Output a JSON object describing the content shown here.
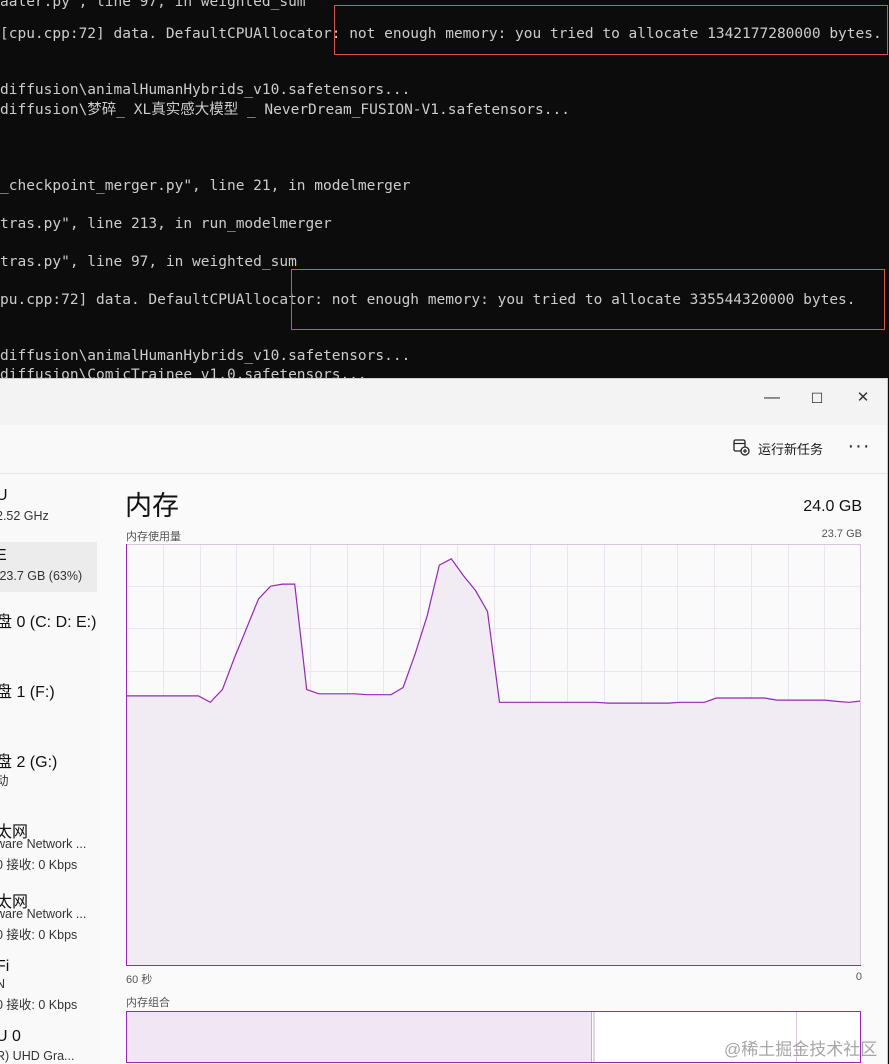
{
  "terminal": {
    "lines": [
      "[cpu.cpp:72] data. DefaultCPUAllocator: not enough memory: you tried to allocate 1342177280000 bytes.",
      "diffusion\\animalHumanHybrids_v10.safetensors...",
      "diffusion\\梦碎_ XL真实感大模型 _ NeverDream_FUSION-V1.safetensors...",
      "_checkpoint_merger.py\", line 21, in modelmerger",
      "tras.py\", line 213, in run_modelmerger",
      "tras.py\", line 97, in weighted_sum",
      "pu.cpp:72] data. DefaultCPUAllocator: not enough memory: you tried to allocate 335544320000 bytes.",
      "diffusion\\animalHumanHybrids_v10.safetensors...",
      "diffusion\\ComicTrainee_v1.0.safetensors..."
    ],
    "top_partial": "aaler.py\", line 97, in weighted_sum",
    "line1": "pu.cpp:72] data. DefaultCPUAllocator: not enough memory: you tried to allocate 1342177280000 bytes."
  },
  "window": {
    "minimize_glyph": "—",
    "maximize_glyph": "☐",
    "close_glyph": "✕"
  },
  "toolbar": {
    "run_task_label": "运行新任务",
    "more_label": "···"
  },
  "sidebar": {
    "items": [
      {
        "name": "U",
        "sub": "2.52 GHz"
      },
      {
        "name": "E",
        "sub": "/23.7 GB (63%)"
      },
      {
        "name": "盘 0 (C: D: E:)",
        "sub": ""
      },
      {
        "name": "盘 1 (F:)",
        "sub": ""
      },
      {
        "name": "盘 2 (G:)",
        "sub": "动"
      },
      {
        "name": "太网",
        "sub": "ware Network ...",
        "sub2": "0  接收: 0 Kbps"
      },
      {
        "name": "太网",
        "sub": "ware Network ...",
        "sub2": "0  接收: 0 Kbps"
      },
      {
        "name": "Fi",
        "sub": "N",
        "sub2": "0  接收: 0 Kbps"
      },
      {
        "name": "U 0",
        "sub": "R) UHD Gra..."
      }
    ]
  },
  "memory": {
    "title": "内存",
    "total": "24.0 GB",
    "usage_label": "内存使用量",
    "max_label": "23.7 GB",
    "x_left": "60 秒",
    "x_right": "0",
    "composition_label": "内存组合",
    "accent": "#9528b4",
    "fill": "#f1ebf4"
  },
  "chart_data": {
    "type": "area",
    "title": "内存使用量",
    "xlabel": "",
    "ylabel": "",
    "x_range": [
      60,
      0
    ],
    "ylim": [
      0,
      23.7
    ],
    "series": [
      {
        "values": [
          64,
          64,
          64,
          64,
          64,
          64,
          64,
          62.5,
          65.5,
          73,
          80,
          87,
          90,
          90.5,
          90.5,
          65.5,
          64.5,
          64.5,
          64.5,
          64.5,
          64.3,
          64.3,
          64.3,
          66,
          74,
          83,
          95,
          96.5,
          92.5,
          89,
          84,
          62.5,
          62.5,
          62.5,
          62.5,
          62.5,
          62.5,
          62.5,
          62.5,
          62.5,
          62.3,
          62.3,
          62.3,
          62.3,
          62.3,
          62.3,
          62.5,
          62.5,
          62.5,
          63.5,
          63.5,
          63.5,
          63.5,
          63.5,
          63,
          63,
          63,
          63,
          63,
          62.7,
          62.5,
          62.8
        ]
      }
    ],
    "value_unit": "% of graph height",
    "grid": true
  },
  "watermark": "@稀土掘金技术社区"
}
